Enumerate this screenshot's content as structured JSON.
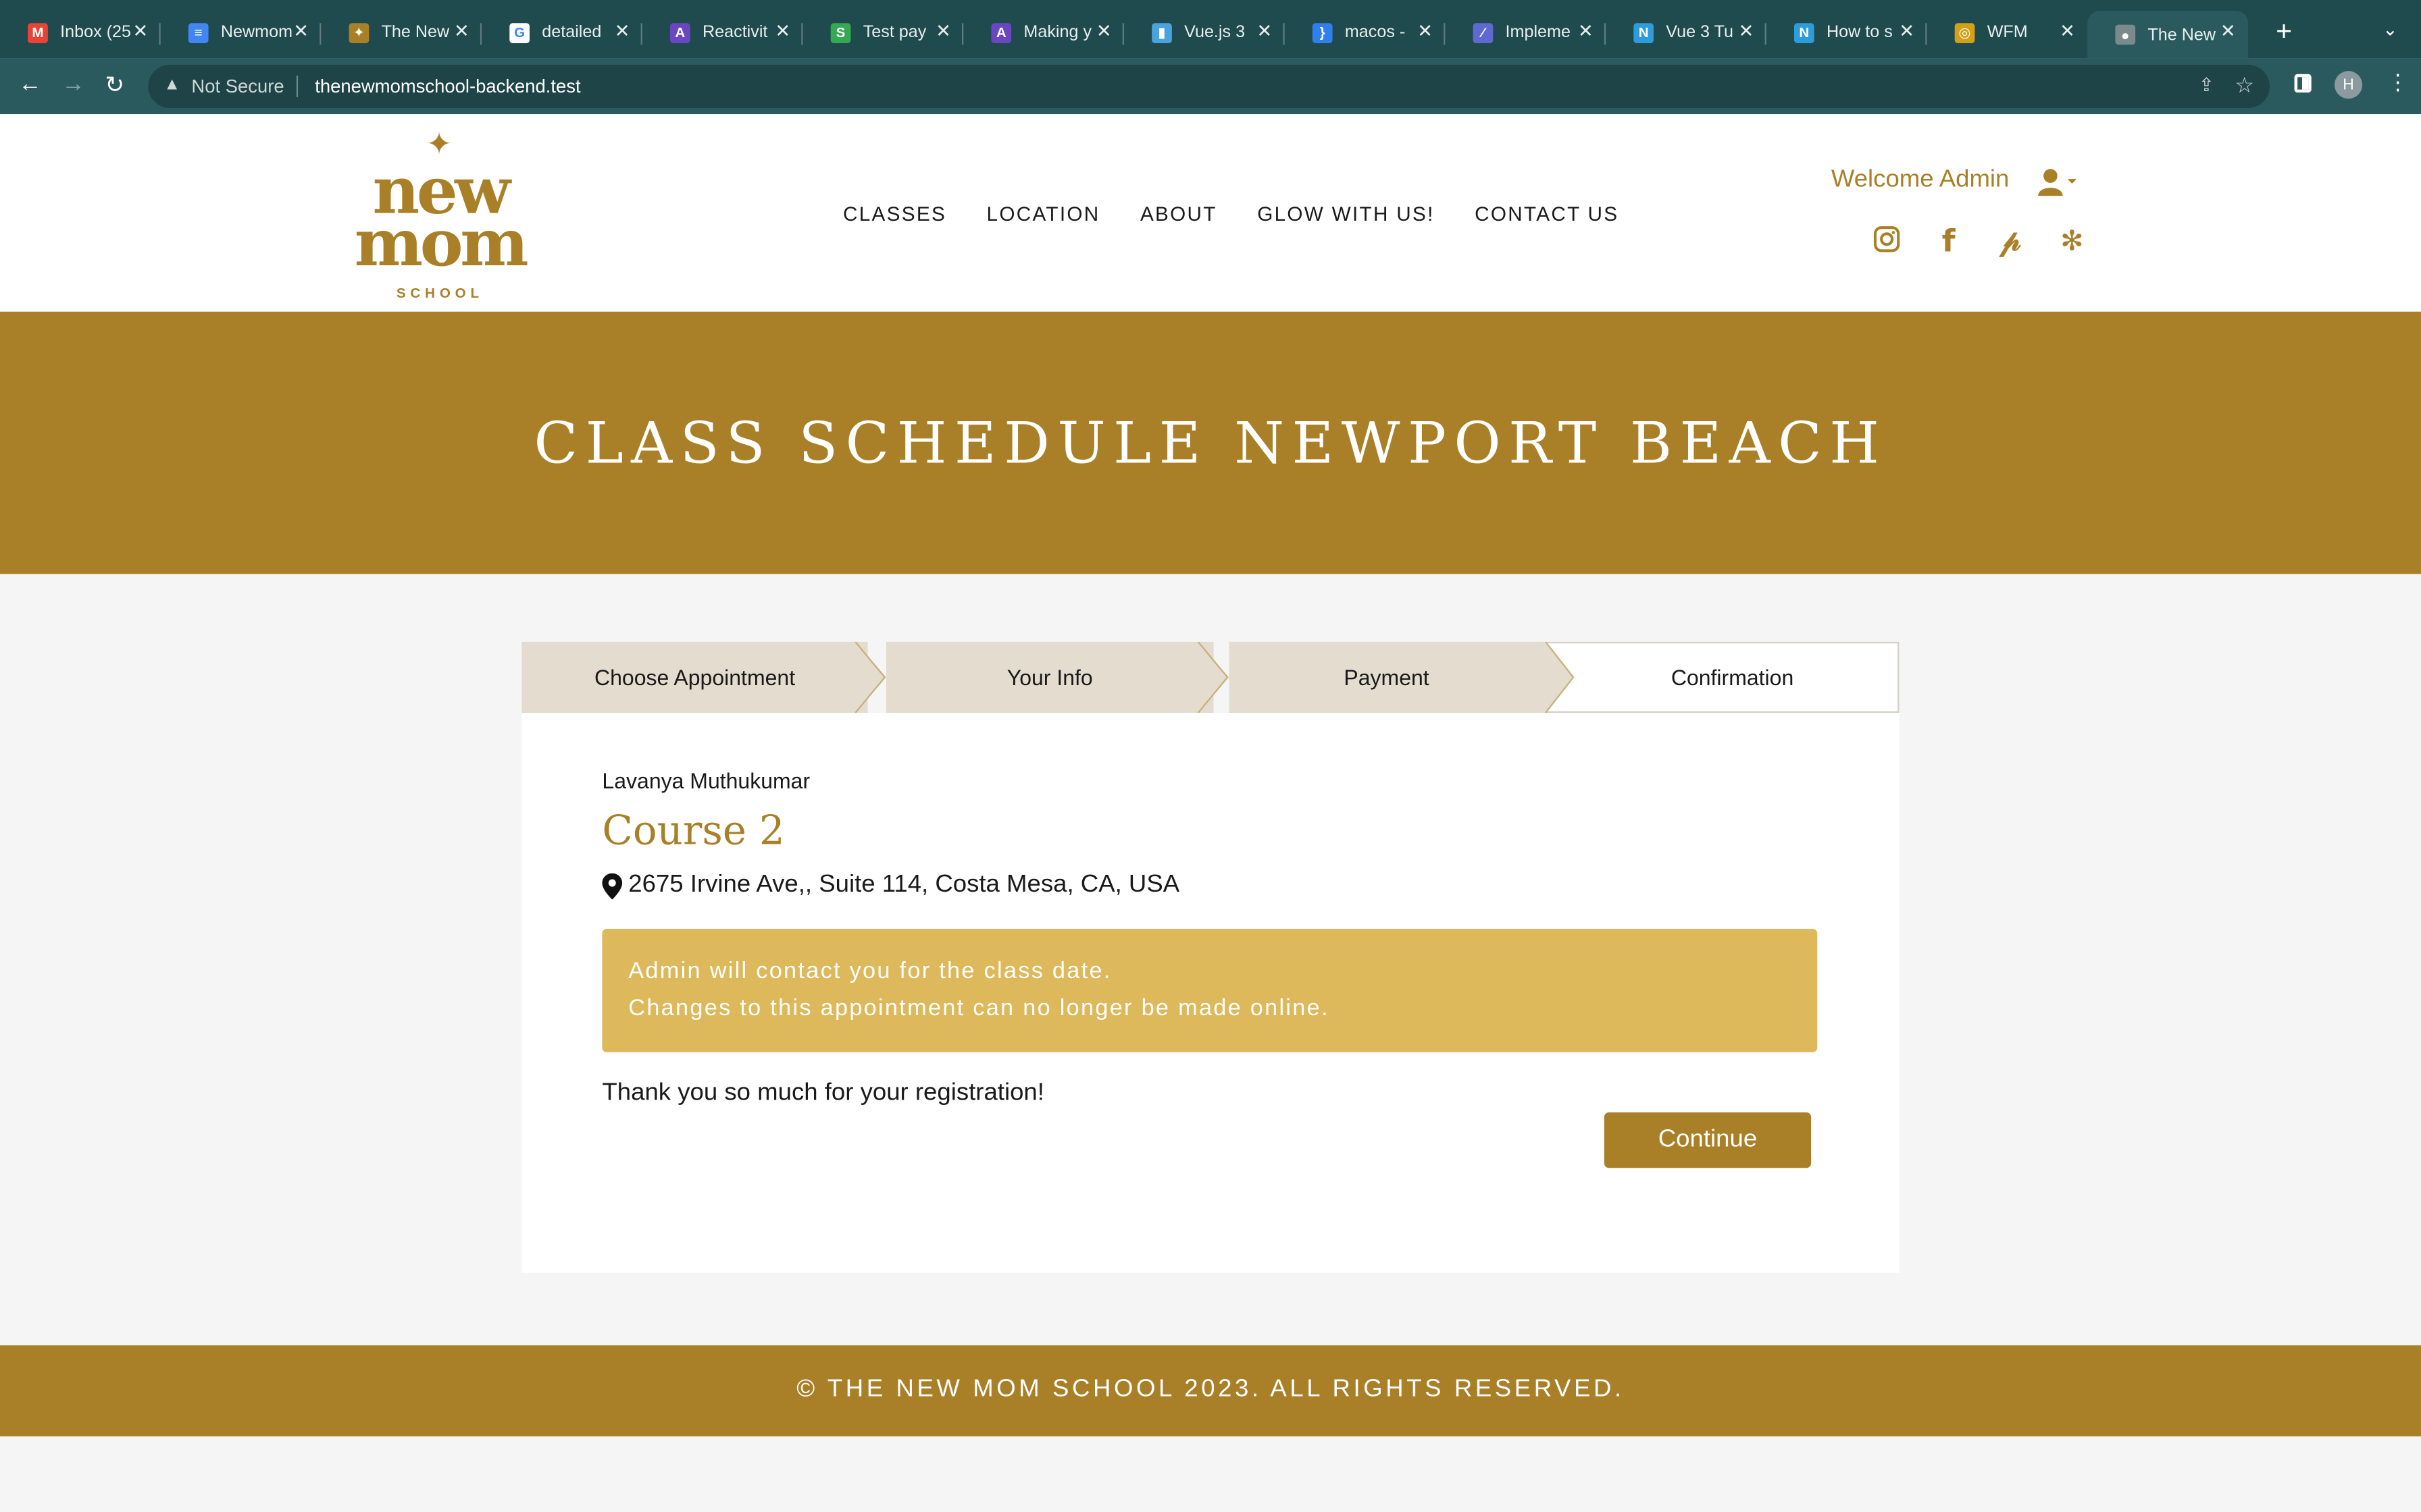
{
  "browser": {
    "tabs": [
      {
        "title": "Inbox (25",
        "icon": "gmail-icon",
        "color": "#ea4335",
        "glyph": "M"
      },
      {
        "title": "Newmom",
        "icon": "docs-icon",
        "color": "#4285f4",
        "glyph": "≡"
      },
      {
        "title": "The New",
        "icon": "newmom-icon",
        "color": "#a98028",
        "glyph": "✦"
      },
      {
        "title": "detailed",
        "icon": "google-icon",
        "color": "#ffffff",
        "glyph": "G"
      },
      {
        "title": "Reactivit",
        "icon": "astro-icon",
        "color": "#6b46c1",
        "glyph": "A"
      },
      {
        "title": "Test pay",
        "icon": "sheets-icon",
        "color": "#34a853",
        "glyph": "S"
      },
      {
        "title": "Making y",
        "icon": "astro-icon",
        "color": "#6b46c1",
        "glyph": "A"
      },
      {
        "title": "Vue.js 3",
        "icon": "chart-icon",
        "color": "#4aa3df",
        "glyph": "▮"
      },
      {
        "title": "macos -",
        "icon": "braces-icon",
        "color": "#2f80ed",
        "glyph": "}"
      },
      {
        "title": "Impleme",
        "icon": "linear-icon",
        "color": "#5e6ad2",
        "glyph": "⁄"
      },
      {
        "title": "Vue 3 Tu",
        "icon": "n-icon",
        "color": "#2d9cdb",
        "glyph": "N"
      },
      {
        "title": "How to s",
        "icon": "n-icon",
        "color": "#2d9cdb",
        "glyph": "N"
      },
      {
        "title": "WFM",
        "icon": "wfm-icon",
        "color": "#d4a017",
        "glyph": "◎"
      },
      {
        "title": "The New",
        "icon": "globe-icon",
        "color": "#7b8a8c",
        "glyph": "●"
      }
    ],
    "not_secure": "Not Secure",
    "url": "thenewmomschool-backend.test",
    "profile_initial": "H"
  },
  "header": {
    "logo": {
      "line1": "new",
      "line2": "mom",
      "line3": "SCHOOL"
    },
    "nav": [
      "CLASSES",
      "LOCATION",
      "ABOUT",
      "GLOW WITH US!",
      "CONTACT US"
    ],
    "welcome": "Welcome Admin",
    "social": [
      {
        "name": "instagram-icon",
        "glyph": "◎"
      },
      {
        "name": "facebook-icon",
        "glyph": "f"
      },
      {
        "name": "pinterest-icon",
        "glyph": "P"
      },
      {
        "name": "yelp-icon",
        "glyph": "✻"
      }
    ]
  },
  "hero": {
    "title": "CLASS SCHEDULE NEWPORT BEACH"
  },
  "steps": [
    {
      "label": "Choose Appointment",
      "active": false
    },
    {
      "label": "Your Info",
      "active": false
    },
    {
      "label": "Payment",
      "active": false
    },
    {
      "label": "Confirmation",
      "active": true
    }
  ],
  "confirmation": {
    "customer_name": "Lavanya Muthukumar",
    "course": "Course 2",
    "address": "2675 Irvine Ave,, Suite 114, Costa Mesa, CA, USA",
    "alert_line1": "Admin will contact you for the class date.",
    "alert_line2": "Changes to this appointment can no longer be made online.",
    "thanks": "Thank you so much for your registration!",
    "continue_label": "Continue"
  },
  "footer": {
    "copyright": "© THE NEW MOM SCHOOL 2023. ALL RIGHTS RESERVED."
  },
  "colors": {
    "brand_gold": "#a98028",
    "alert_gold": "#ddb95c",
    "chrome_teal": "#2a5a5e",
    "step_bg": "#e3dccf"
  }
}
